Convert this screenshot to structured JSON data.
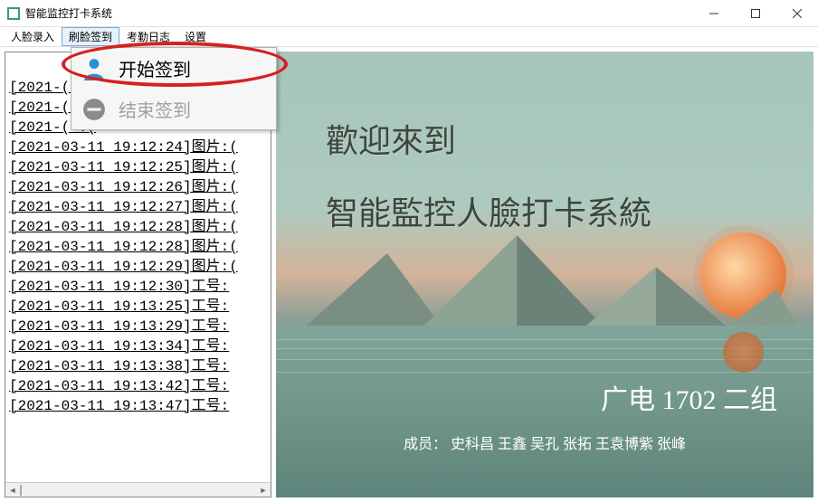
{
  "window": {
    "title": "智能监控打卡系统"
  },
  "menu": {
    "items": [
      "人脸录入",
      "刷脸签到",
      "考勤日志",
      "设置"
    ],
    "active_index": 1
  },
  "dropdown": {
    "start": "开始签到",
    "end": "结束签到"
  },
  "log": {
    "lines": [
      "[2021-(                   )",
      "[2021-(                  :(",
      "[2021-(                  :(",
      "[2021-03-11 19:12:24]图片:(",
      "[2021-03-11 19:12:25]图片:(",
      "[2021-03-11 19:12:26]图片:(",
      "[2021-03-11 19:12:27]图片:(",
      "[2021-03-11 19:12:28]图片:(",
      "[2021-03-11 19:12:28]图片:(",
      "[2021-03-11 19:12:29]图片:(",
      "[2021-03-11 19:12:30]工号:",
      "[2021-03-11 19:13:25]工号:",
      "[2021-03-11 19:13:29]工号:",
      "[2021-03-11 19:13:34]工号:",
      "[2021-03-11 19:13:38]工号:",
      "[2021-03-11 19:13:42]工号:",
      "[2021-03-11 19:13:47]工号:"
    ]
  },
  "welcome": {
    "line1": "歡迎來到",
    "line2": "智能監控人臉打卡系統",
    "group": "广电 1702 二组",
    "members": "成员： 史科昌  王鑫  吴孔  张拓  王袁博紫  张峰"
  }
}
